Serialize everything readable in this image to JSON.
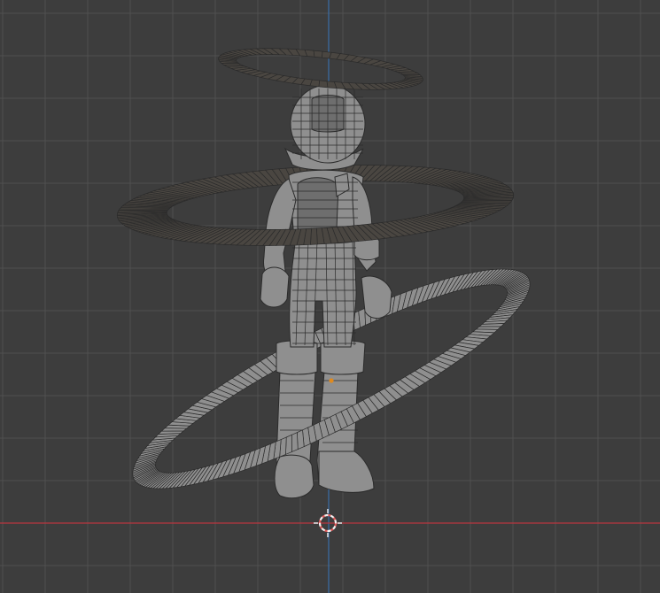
{
  "viewport": {
    "background": "#3d3d3d",
    "grid_minor_color": "#474747",
    "grid_major_color": "#505050",
    "x_axis_color": "#b8363f",
    "z_axis_color": "#3a6ea8"
  },
  "scene": {
    "mesh_fill": "#8f8f8f",
    "mesh_shadow": "#6e6e6e",
    "wire_color": "#2b2b2b",
    "ring_dark_fill": "#4a4641",
    "origin_dot_color": "#e08a1e",
    "cursor_color_a": "#e05a5a",
    "cursor_color_b": "#f2f2f2",
    "cursor_icon": "3d-cursor-icon"
  }
}
